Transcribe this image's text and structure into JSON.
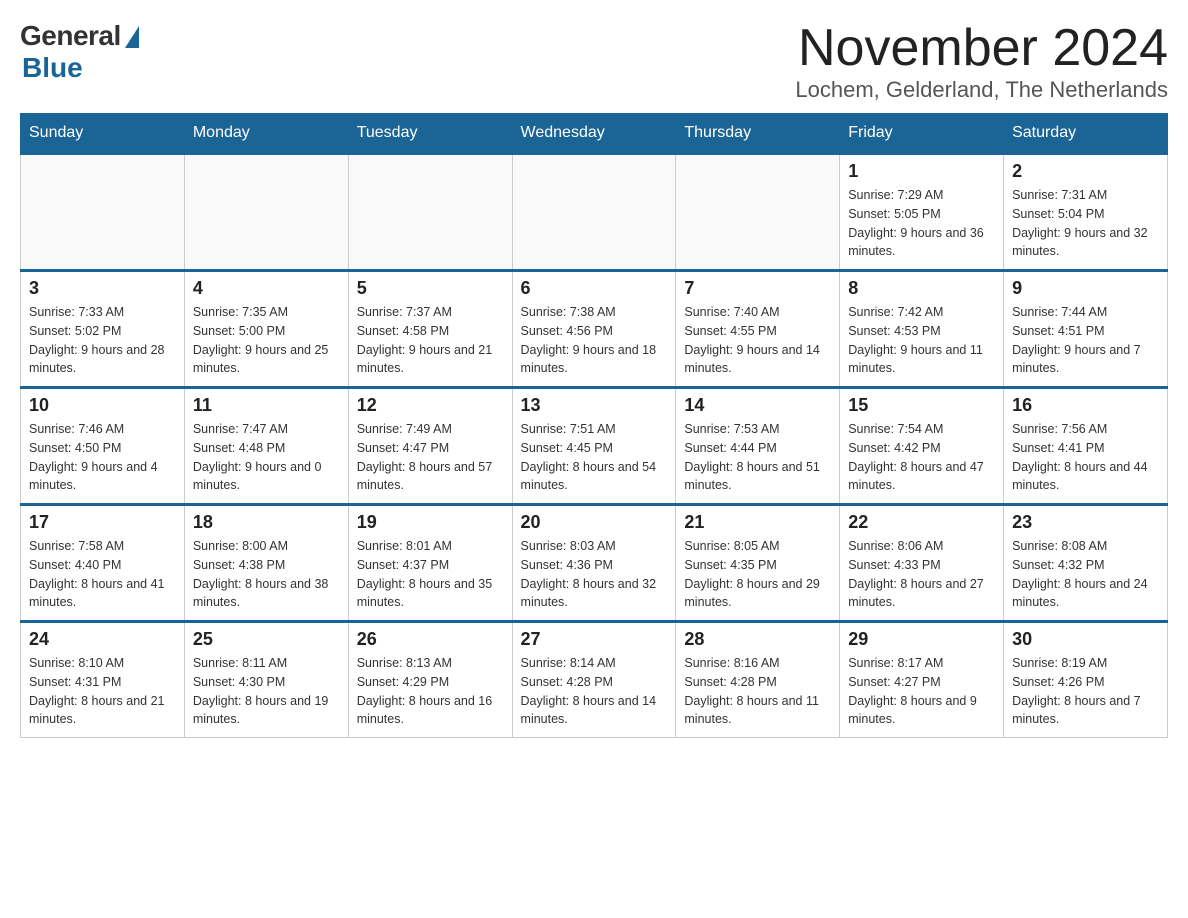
{
  "header": {
    "logo_general": "General",
    "logo_blue": "Blue",
    "month_title": "November 2024",
    "subtitle": "Lochem, Gelderland, The Netherlands"
  },
  "days_of_week": [
    "Sunday",
    "Monday",
    "Tuesday",
    "Wednesday",
    "Thursday",
    "Friday",
    "Saturday"
  ],
  "weeks": [
    [
      {
        "day": "",
        "info": ""
      },
      {
        "day": "",
        "info": ""
      },
      {
        "day": "",
        "info": ""
      },
      {
        "day": "",
        "info": ""
      },
      {
        "day": "",
        "info": ""
      },
      {
        "day": "1",
        "info": "Sunrise: 7:29 AM\nSunset: 5:05 PM\nDaylight: 9 hours and 36 minutes."
      },
      {
        "day": "2",
        "info": "Sunrise: 7:31 AM\nSunset: 5:04 PM\nDaylight: 9 hours and 32 minutes."
      }
    ],
    [
      {
        "day": "3",
        "info": "Sunrise: 7:33 AM\nSunset: 5:02 PM\nDaylight: 9 hours and 28 minutes."
      },
      {
        "day": "4",
        "info": "Sunrise: 7:35 AM\nSunset: 5:00 PM\nDaylight: 9 hours and 25 minutes."
      },
      {
        "day": "5",
        "info": "Sunrise: 7:37 AM\nSunset: 4:58 PM\nDaylight: 9 hours and 21 minutes."
      },
      {
        "day": "6",
        "info": "Sunrise: 7:38 AM\nSunset: 4:56 PM\nDaylight: 9 hours and 18 minutes."
      },
      {
        "day": "7",
        "info": "Sunrise: 7:40 AM\nSunset: 4:55 PM\nDaylight: 9 hours and 14 minutes."
      },
      {
        "day": "8",
        "info": "Sunrise: 7:42 AM\nSunset: 4:53 PM\nDaylight: 9 hours and 11 minutes."
      },
      {
        "day": "9",
        "info": "Sunrise: 7:44 AM\nSunset: 4:51 PM\nDaylight: 9 hours and 7 minutes."
      }
    ],
    [
      {
        "day": "10",
        "info": "Sunrise: 7:46 AM\nSunset: 4:50 PM\nDaylight: 9 hours and 4 minutes."
      },
      {
        "day": "11",
        "info": "Sunrise: 7:47 AM\nSunset: 4:48 PM\nDaylight: 9 hours and 0 minutes."
      },
      {
        "day": "12",
        "info": "Sunrise: 7:49 AM\nSunset: 4:47 PM\nDaylight: 8 hours and 57 minutes."
      },
      {
        "day": "13",
        "info": "Sunrise: 7:51 AM\nSunset: 4:45 PM\nDaylight: 8 hours and 54 minutes."
      },
      {
        "day": "14",
        "info": "Sunrise: 7:53 AM\nSunset: 4:44 PM\nDaylight: 8 hours and 51 minutes."
      },
      {
        "day": "15",
        "info": "Sunrise: 7:54 AM\nSunset: 4:42 PM\nDaylight: 8 hours and 47 minutes."
      },
      {
        "day": "16",
        "info": "Sunrise: 7:56 AM\nSunset: 4:41 PM\nDaylight: 8 hours and 44 minutes."
      }
    ],
    [
      {
        "day": "17",
        "info": "Sunrise: 7:58 AM\nSunset: 4:40 PM\nDaylight: 8 hours and 41 minutes."
      },
      {
        "day": "18",
        "info": "Sunrise: 8:00 AM\nSunset: 4:38 PM\nDaylight: 8 hours and 38 minutes."
      },
      {
        "day": "19",
        "info": "Sunrise: 8:01 AM\nSunset: 4:37 PM\nDaylight: 8 hours and 35 minutes."
      },
      {
        "day": "20",
        "info": "Sunrise: 8:03 AM\nSunset: 4:36 PM\nDaylight: 8 hours and 32 minutes."
      },
      {
        "day": "21",
        "info": "Sunrise: 8:05 AM\nSunset: 4:35 PM\nDaylight: 8 hours and 29 minutes."
      },
      {
        "day": "22",
        "info": "Sunrise: 8:06 AM\nSunset: 4:33 PM\nDaylight: 8 hours and 27 minutes."
      },
      {
        "day": "23",
        "info": "Sunrise: 8:08 AM\nSunset: 4:32 PM\nDaylight: 8 hours and 24 minutes."
      }
    ],
    [
      {
        "day": "24",
        "info": "Sunrise: 8:10 AM\nSunset: 4:31 PM\nDaylight: 8 hours and 21 minutes."
      },
      {
        "day": "25",
        "info": "Sunrise: 8:11 AM\nSunset: 4:30 PM\nDaylight: 8 hours and 19 minutes."
      },
      {
        "day": "26",
        "info": "Sunrise: 8:13 AM\nSunset: 4:29 PM\nDaylight: 8 hours and 16 minutes."
      },
      {
        "day": "27",
        "info": "Sunrise: 8:14 AM\nSunset: 4:28 PM\nDaylight: 8 hours and 14 minutes."
      },
      {
        "day": "28",
        "info": "Sunrise: 8:16 AM\nSunset: 4:28 PM\nDaylight: 8 hours and 11 minutes."
      },
      {
        "day": "29",
        "info": "Sunrise: 8:17 AM\nSunset: 4:27 PM\nDaylight: 8 hours and 9 minutes."
      },
      {
        "day": "30",
        "info": "Sunrise: 8:19 AM\nSunset: 4:26 PM\nDaylight: 8 hours and 7 minutes."
      }
    ]
  ]
}
